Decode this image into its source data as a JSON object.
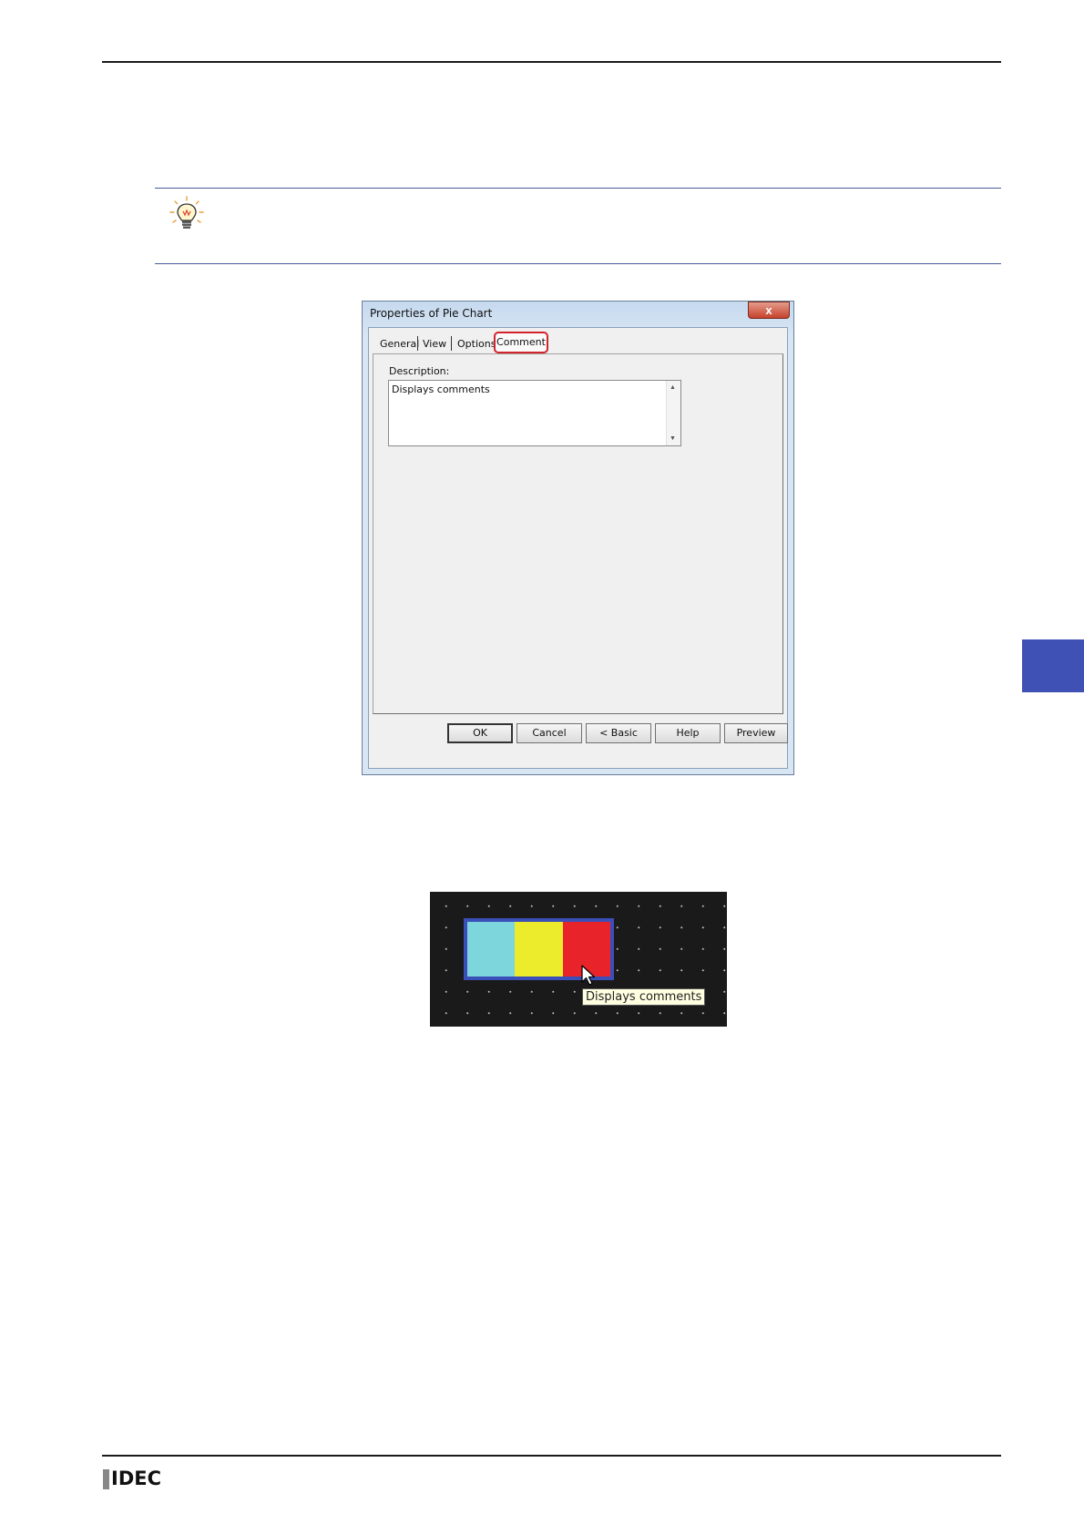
{
  "dialog": {
    "title": "Properties of Pie Chart",
    "close_label": "x",
    "tabs": [
      {
        "label": "General"
      },
      {
        "label": "View"
      },
      {
        "label": "Options"
      },
      {
        "label": "Comment"
      }
    ],
    "active_tab": "Comment",
    "description_label": "Description:",
    "description_value": "Displays comments",
    "buttons": {
      "ok": "OK",
      "cancel": "Cancel",
      "basic": "< Basic",
      "help": "Help",
      "preview": "Preview"
    }
  },
  "preview": {
    "tooltip": "Displays comments",
    "segment_colors": [
      "#7dd6dc",
      "#ecec2c",
      "#e8242a"
    ],
    "frame_color": "#3a4fb8"
  },
  "side_tab_color": "#3f51b5",
  "footer": {
    "logo": "IDEC"
  },
  "icons": {
    "tip": "lightbulb-icon",
    "cursor": "mouse-pointer-icon"
  }
}
